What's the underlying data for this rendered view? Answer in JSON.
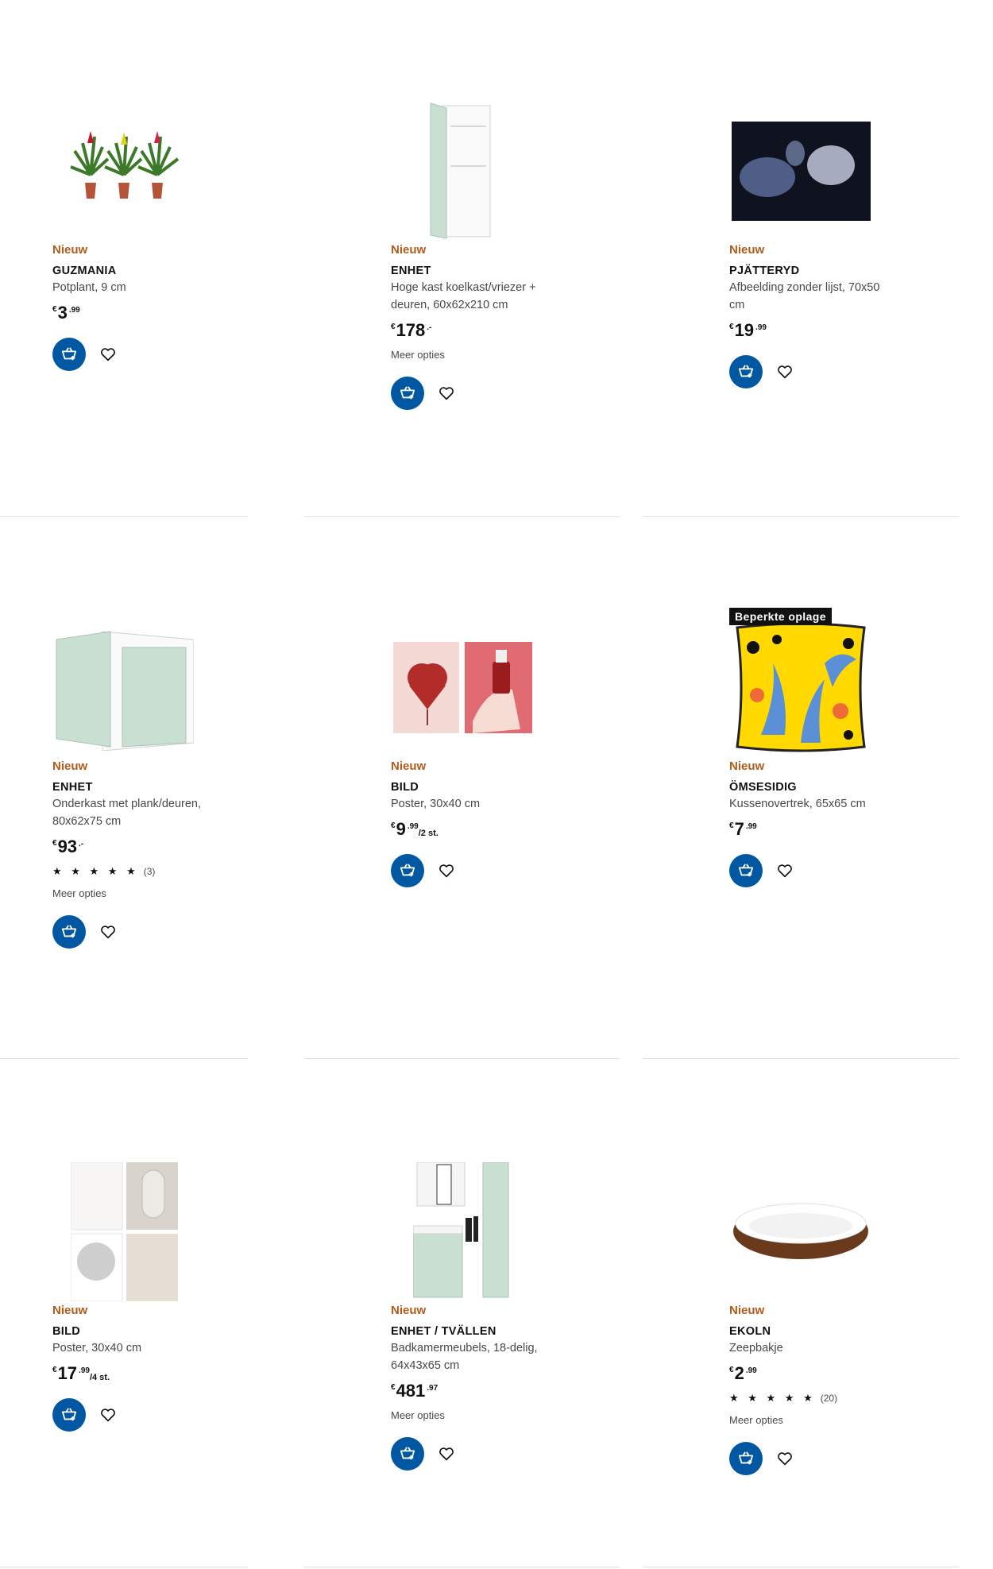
{
  "products": [
    {
      "badge": "Nieuw",
      "name": "GUZMANIA",
      "description": "Potplant, 9 cm",
      "currency": "€",
      "price_int": "3",
      "price_dec": ".99",
      "icon": "potted-plants-image"
    },
    {
      "badge": "Nieuw",
      "name": "ENHET",
      "description": "Hoge kast koelkast/vriezer + deuren, 60x62x210 cm",
      "currency": "€",
      "price_int": "178",
      "price_dec": ".-",
      "more": "Meer opties",
      "icon": "tall-cabinet-image"
    },
    {
      "badge": "Nieuw",
      "name": "PJÄTTERYD",
      "description": "Afbeelding zonder lijst, 70x50 cm",
      "currency": "€",
      "price_int": "19",
      "price_dec": ".99",
      "icon": "ballet-picture-image"
    },
    {
      "badge": "Nieuw",
      "name": "ENHET",
      "description": "Onderkast met plank/deuren, 80x62x75 cm",
      "currency": "€",
      "price_int": "93",
      "price_dec": ".-",
      "rating": 5,
      "rating_count": "(3)",
      "more": "Meer opties",
      "icon": "base-cabinet-image"
    },
    {
      "badge": "Nieuw",
      "name": "BILD",
      "description": "Poster, 30x40 cm",
      "currency": "€",
      "price_int": "9",
      "price_dec": ".99",
      "unit": "/2 st.",
      "icon": "love-posters-image"
    },
    {
      "badge": "Nieuw",
      "name": "ÖMSESIDIG",
      "description": "Kussenovertrek, 65x65 cm",
      "currency": "€",
      "price_int": "7",
      "price_dec": ".99",
      "limited": "Beperkte oplage",
      "icon": "cushion-cover-image"
    },
    {
      "badge": "Nieuw",
      "name": "BILD",
      "description": "Poster, 30x40 cm",
      "currency": "€",
      "price_int": "17",
      "price_dec": ".99",
      "unit": "/4 st.",
      "icon": "poster-set-image"
    },
    {
      "badge": "Nieuw",
      "name": "ENHET / TVÄLLEN",
      "description": "Badkamermeubels, 18-delig, 64x43x65 cm",
      "currency": "€",
      "price_int": "481",
      "price_dec": ".97",
      "more": "Meer opties",
      "icon": "bathroom-furniture-image"
    },
    {
      "badge": "Nieuw",
      "name": "EKOLN",
      "description": "Zeepbakje",
      "currency": "€",
      "price_int": "2",
      "price_dec": ".99",
      "rating": 5,
      "rating_count": "(20)",
      "more": "Meer opties",
      "icon": "soap-dish-image"
    }
  ],
  "colors": {
    "accent": "#0058a3",
    "new_badge": "#b25b1b",
    "limited_badge_bg": "#111111"
  },
  "star_glyph": "★ ★ ★ ★ ★"
}
